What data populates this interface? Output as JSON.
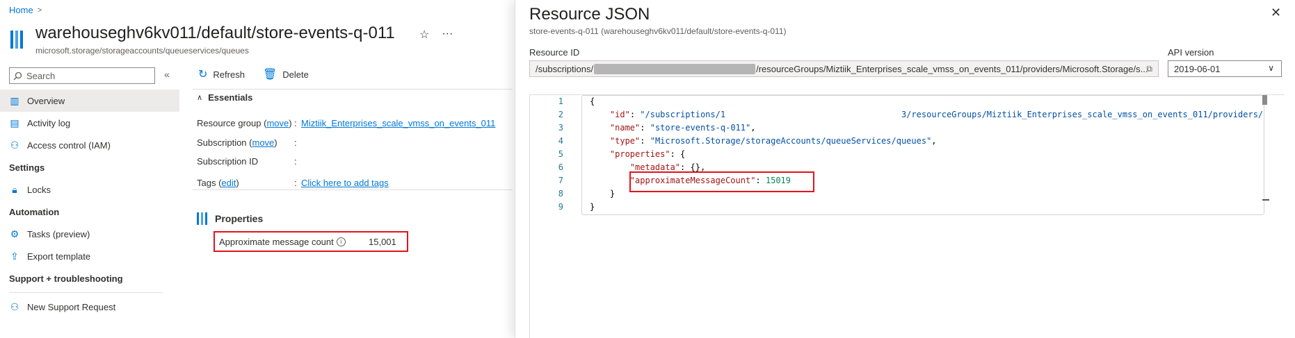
{
  "breadcrumb": {
    "home": "Home"
  },
  "header": {
    "title": "warehouseghv6kv011/default/store-events-q-011",
    "subtitle": "microsoft.storage/storageaccounts/queueservices/queues",
    "favorite_icon": "star-icon",
    "more_label": "···"
  },
  "sidebar": {
    "search_placeholder": "Search",
    "collapse_label": "«",
    "items_top": [
      {
        "label": "Overview",
        "icon": "overview-icon",
        "active": true
      },
      {
        "label": "Activity log",
        "icon": "activity-log-icon"
      },
      {
        "label": "Access control (IAM)",
        "icon": "iam-icon"
      }
    ],
    "sections": [
      {
        "title": "Settings",
        "items": [
          {
            "label": "Locks",
            "icon": "lock-icon"
          }
        ]
      },
      {
        "title": "Automation",
        "items": [
          {
            "label": "Tasks (preview)",
            "icon": "tasks-icon"
          },
          {
            "label": "Export template",
            "icon": "export-icon"
          }
        ]
      },
      {
        "title": "Support + troubleshooting",
        "items": [
          {
            "label": "New Support Request",
            "icon": "support-icon"
          }
        ]
      }
    ]
  },
  "toolbar": {
    "refresh_label": "Refresh",
    "delete_label": "Delete"
  },
  "essentials": {
    "heading": "Essentials",
    "rows": [
      {
        "label": "Resource group",
        "paren_link": "move",
        "value": "Miztiik_Enterprises_scale_vmss_on_events_011"
      },
      {
        "label": "Subscription",
        "paren_link": "move",
        "value": ""
      },
      {
        "label": "Subscription ID",
        "value": ""
      },
      {
        "label": "Tags",
        "paren_link": "edit",
        "value": "Click here to add tags"
      }
    ]
  },
  "properties": {
    "heading": "Properties",
    "approx_label": "Approximate message count",
    "approx_value": "15,001"
  },
  "panel": {
    "title": "Resource JSON",
    "subtitle": "store-events-q-011 (warehouseghv6kv011/default/store-events-q-011)",
    "resource_id_label": "Resource ID",
    "resource_id_prefix": "/subscriptions/",
    "resource_id_suffix": "/resourceGroups/Miztiik_Enterprises_scale_vmss_on_events_011/providers/Microsoft.Storage/s...",
    "api_label": "API version",
    "api_value": "2019-06-01",
    "json_lines": {
      "l1": "{",
      "id_key": "\"id\"",
      "id_val_a": "\"/subscriptions/1",
      "id_val_b": "3/resourceGroups/Miztiik_Enterprises_scale_vmss_on_events_011/providers/",
      "name_key": "\"name\"",
      "name_val": "\"store-events-q-011\"",
      "type_key": "\"type\"",
      "type_val": "\"Microsoft.Storage/storageAccounts/queueServices/queues\"",
      "props_key": "\"properties\"",
      "meta_key": "\"metadata\"",
      "amc_key": "\"approximateMessageCount\"",
      "amc_val": "15019",
      "close_inner": "}",
      "close_outer": "}"
    },
    "line_numbers": [
      "1",
      "2",
      "3",
      "4",
      "5",
      "6",
      "7",
      "8",
      "9"
    ]
  },
  "colors": {
    "accent": "#0078d4",
    "highlight": "#e3121a"
  }
}
